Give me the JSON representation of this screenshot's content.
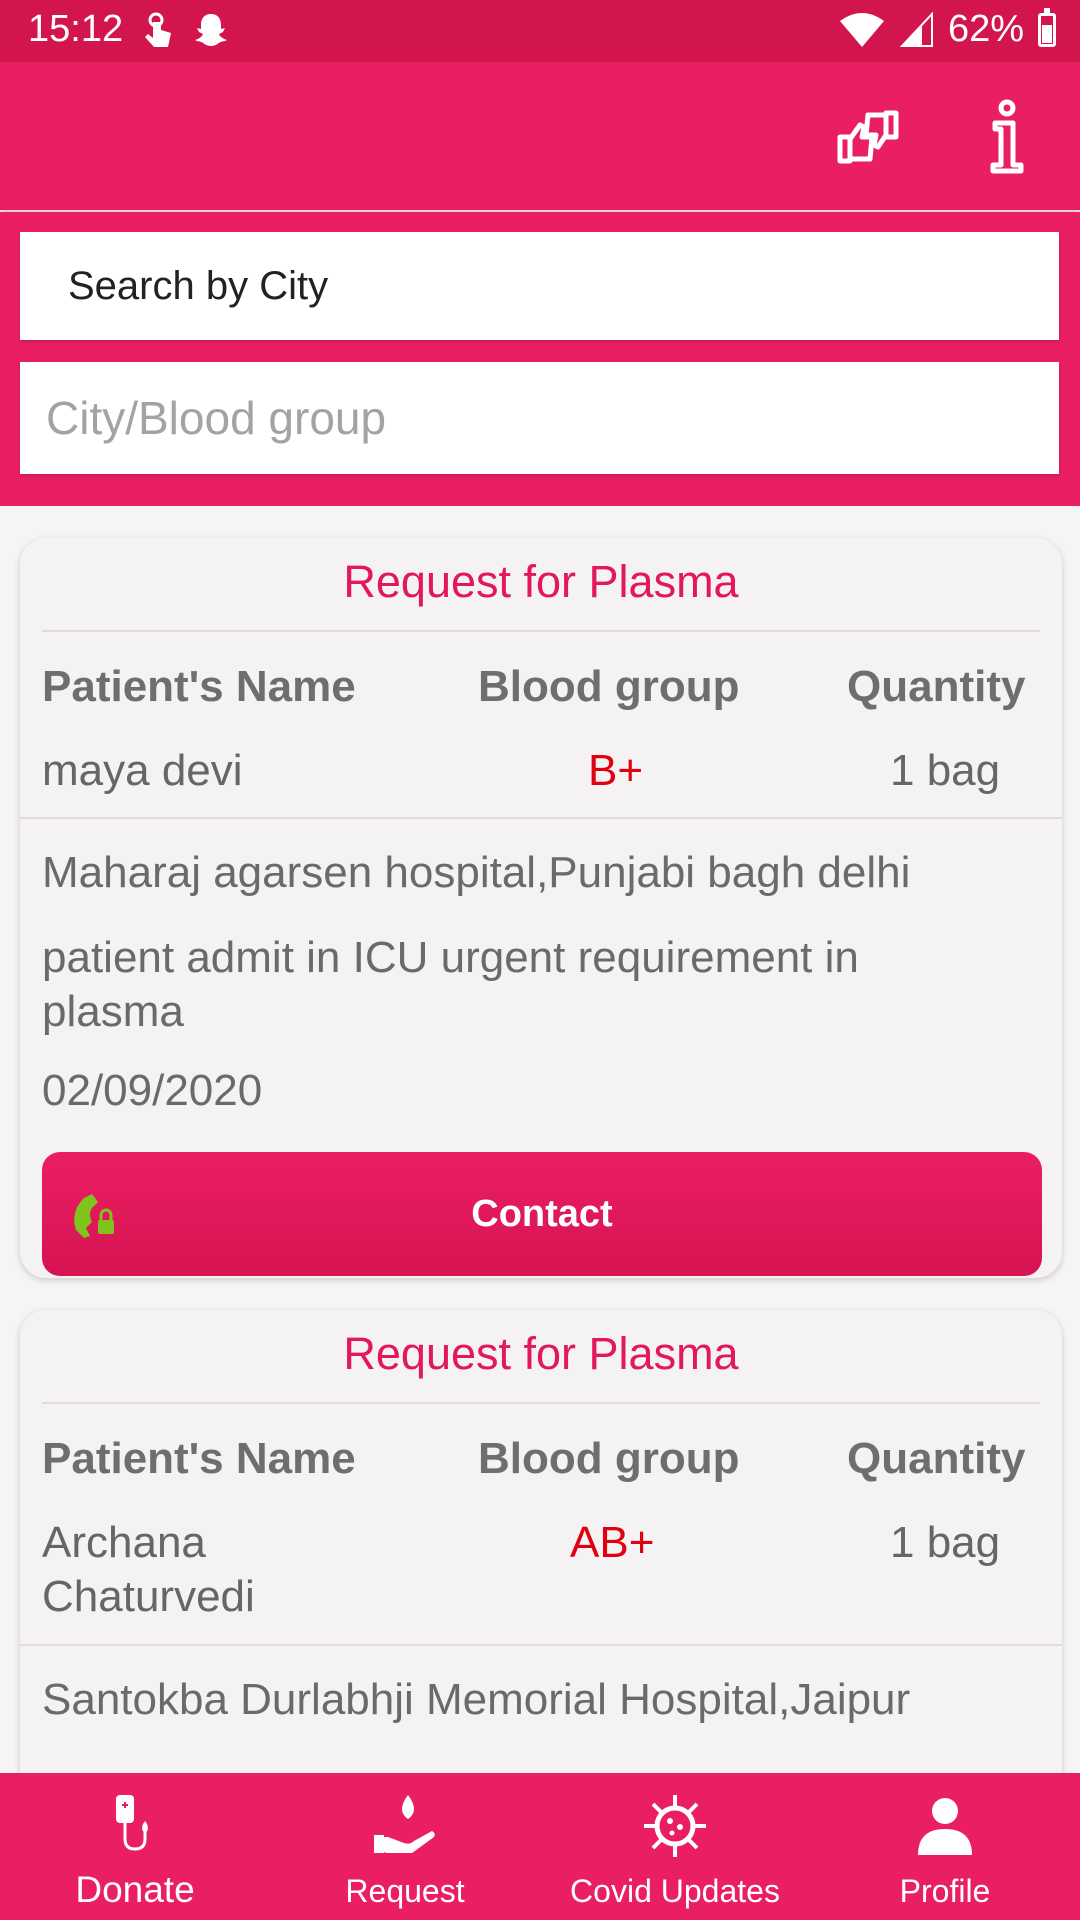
{
  "status_bar": {
    "time": "15:12",
    "battery": "62%"
  },
  "search": {
    "label": "Search by City",
    "placeholder": "City/Blood group"
  },
  "cards": [
    {
      "title": "Request for Plasma",
      "headers": {
        "name": "Patient's Name",
        "blood": "Blood group",
        "qty": "Quantity"
      },
      "patient": "maya devi",
      "blood_group": "B+",
      "quantity": "1 bag",
      "hospital": "Maharaj agarsen hospital,Punjabi bagh delhi",
      "note": "patient admit in ICU urgent requirement in plasma",
      "date": "02/09/2020",
      "contact_label": "Contact"
    },
    {
      "title": "Request for Plasma",
      "headers": {
        "name": "Patient's Name",
        "blood": "Blood group",
        "qty": "Quantity"
      },
      "patient_line1": "Archana",
      "patient_line2": "Chaturvedi",
      "blood_group": "AB+",
      "quantity": "1 bag",
      "hospital": "Santokba Durlabhji Memorial Hospital,Jaipur"
    }
  ],
  "bottom_nav": [
    {
      "label": "Donate",
      "icon": "blood-bag-icon"
    },
    {
      "label": "Request",
      "icon": "hand-drop-icon"
    },
    {
      "label": "Covid Updates",
      "icon": "virus-icon"
    },
    {
      "label": "Profile",
      "icon": "person-icon"
    }
  ],
  "colors": {
    "primary": "#ea1e63",
    "status": "#d3154e",
    "blood_text": "#e00010",
    "phone_icon": "#7fc31c"
  }
}
